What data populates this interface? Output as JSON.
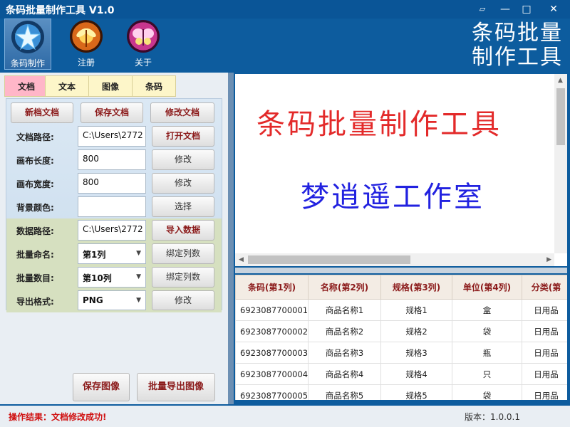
{
  "window": {
    "title": "条码批量制作工具 V1.0",
    "controls": [
      "pin-icon",
      "minimize-icon",
      "maximize-icon",
      "close-icon"
    ]
  },
  "toolbar": {
    "items": [
      {
        "label": "条码制作",
        "icon": "star-icon"
      },
      {
        "label": "注册",
        "icon": "dragonfly-icon"
      },
      {
        "label": "关于",
        "icon": "butterfly-icon"
      }
    ]
  },
  "brand": {
    "line1": "条码批量",
    "line2": "制作工具"
  },
  "tabs": [
    "文档",
    "文本",
    "图像",
    "条码"
  ],
  "form": {
    "new_doc": "新档文档",
    "save_doc": "保存文档",
    "edit_doc": "修改文档",
    "doc_path_label": "文档路径:",
    "doc_path_value": "C:\\Users\\2772",
    "open_doc": "打开文档",
    "canvas_length_label": "画布长度:",
    "canvas_length_value": "800",
    "canvas_width_label": "画布宽度:",
    "canvas_width_value": "800",
    "modify": "修改",
    "bg_color_label": "背景颜色:",
    "choose": "选择",
    "data_path_label": "数据路径:",
    "data_path_value": "C:\\Users\\2772",
    "import_data": "导入数据",
    "batch_name_label": "批量命名:",
    "batch_name_value": "第1列",
    "bind_column": "绑定列数",
    "batch_count_label": "批量数目:",
    "batch_count_value": "第10列",
    "export_format_label": "导出格式:",
    "export_format_value": "PNG"
  },
  "bottom": {
    "save_image": "保存图像",
    "batch_export": "批量导出图像"
  },
  "preview": {
    "line1": "条码批量制作工具",
    "line2": "梦逍遥工作室",
    "line1_color": "#e32a2a",
    "line2_color": "#2222e0"
  },
  "table": {
    "headers": [
      "条码(第1列)",
      "名称(第2列)",
      "规格(第3列)",
      "单位(第4列)",
      "分类(第"
    ],
    "rows": [
      [
        "6923087700001",
        "商品名称1",
        "规格1",
        "盒",
        "日用品"
      ],
      [
        "6923087700002",
        "商品名称2",
        "规格2",
        "袋",
        "日用品"
      ],
      [
        "6923087700003",
        "商品名称3",
        "规格3",
        "瓶",
        "日用品"
      ],
      [
        "6923087700004",
        "商品名称4",
        "规格4",
        "只",
        "日用品"
      ],
      [
        "6923087700005",
        "商品名称5",
        "规格5",
        "袋",
        "日用品"
      ]
    ]
  },
  "status": {
    "message": "操作结果：文档修改成功!",
    "version": "版本：1.0.0.1"
  }
}
